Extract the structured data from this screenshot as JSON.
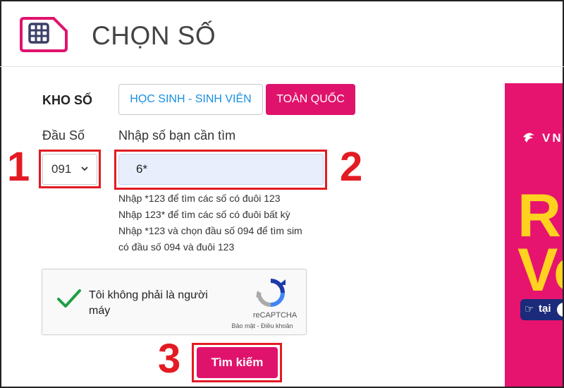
{
  "header": {
    "title": "CHỌN SỐ",
    "icon": "sim-card-icon",
    "accent": "#e0136c"
  },
  "kho_so": {
    "label": "KHO SỐ",
    "tabs": [
      {
        "label": "HỌC SINH - SINH VIÊN",
        "active": false
      },
      {
        "label": "TOÀN QUỐC",
        "active": true
      }
    ]
  },
  "prefix": {
    "label": "Đầu Số",
    "value": "091"
  },
  "search": {
    "label": "Nhập số bạn cần tìm",
    "value": "6*"
  },
  "hints": [
    "Nhập *123 để tìm các số có đuôi 123",
    "Nhập 123* để tìm các số có đuôi bất kỳ",
    "Nhập *123 và chọn đầu số 094 để tìm sim",
    "có đầu số 094 và đuôi 123"
  ],
  "captcha": {
    "line1": "Tôi không phải là người",
    "line2": "máy",
    "brand": "reCAPTCHA",
    "terms": "Bảo mật - Điều khoản",
    "checked": true
  },
  "button": {
    "label": "Tìm kiếm"
  },
  "steps": {
    "one": "1",
    "two": "2",
    "three": "3"
  },
  "ad": {
    "logo_text": "VN",
    "big1": "Rồ",
    "big2": "Vo",
    "pill": "tại"
  },
  "colors": {
    "brand": "#e0136c",
    "highlight": "#e31b23",
    "link": "#1a8fe3",
    "ad_text": "#ffd21f"
  }
}
